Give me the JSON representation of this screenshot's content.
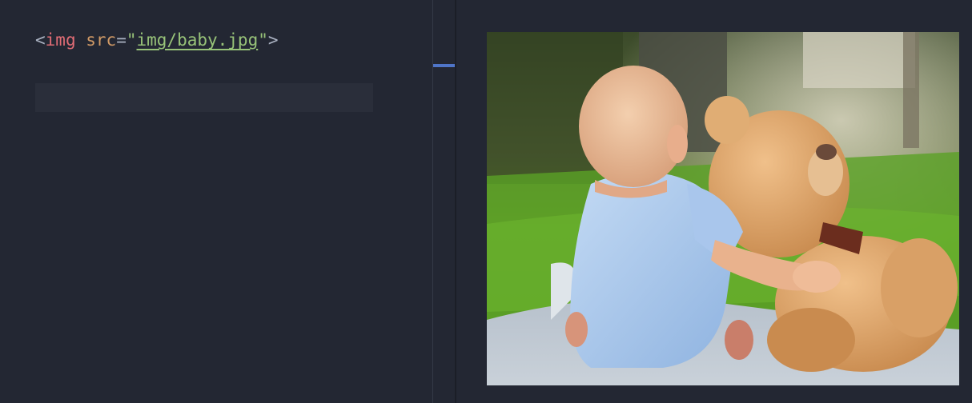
{
  "editor": {
    "code": {
      "open_bracket": "<",
      "tag": "img",
      "space": " ",
      "attr_name": "src",
      "equals": "=",
      "quote_open": "\"",
      "attr_value": "img/baby.jpg",
      "quote_close": "\"",
      "close_bracket": ">"
    }
  },
  "preview": {
    "image_icon": "photo-baby-teddy-bear"
  },
  "colors": {
    "background": "#232733",
    "tag": "#e06c75",
    "attribute": "#d19a66",
    "string": "#98c379",
    "punctuation": "#aab2c2",
    "gutter_marker": "#4f75c8"
  }
}
